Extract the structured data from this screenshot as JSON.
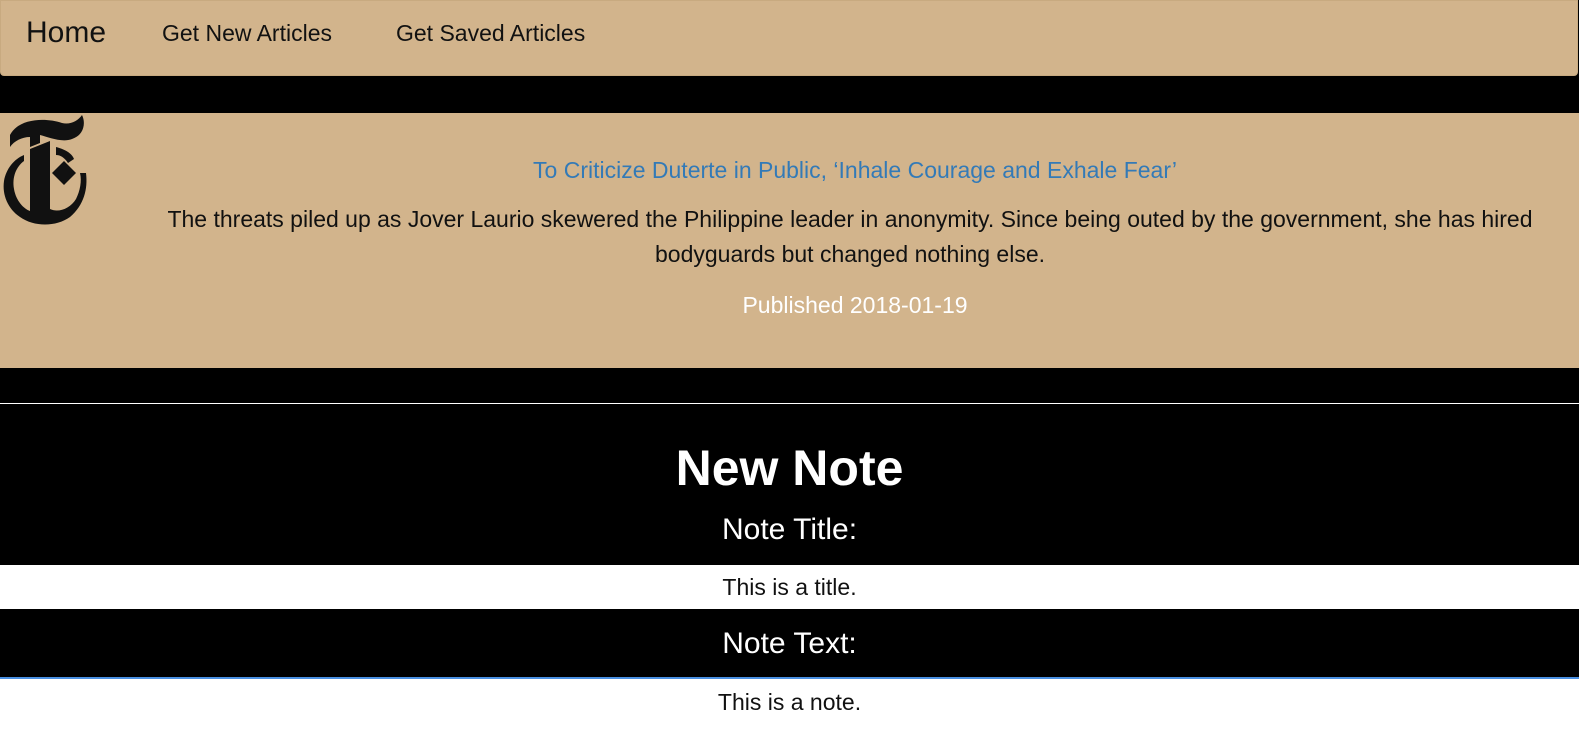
{
  "nav": {
    "brand": "Home",
    "links": [
      {
        "label": "Get New Articles"
      },
      {
        "label": "Get Saved Articles"
      }
    ]
  },
  "article": {
    "logo_icon": "nyt-logo-icon",
    "title": "To Criticize Duterte in Public, ‘Inhale Courage and Exhale Fear’",
    "summary": "The threats piled up as Jover Laurio skewered the Philippine leader in anonymity. Since being outed by the government, she has hired bodyguards but changed nothing else.",
    "published": "Published 2018-01-19"
  },
  "note_form": {
    "heading": "New Note",
    "title_label": "Note Title:",
    "title_value": "This is a title.",
    "text_label": "Note Text:",
    "text_value": "This is a note."
  },
  "colors": {
    "navbar_bg": "#d2b48c",
    "page_bg": "#000000",
    "link_blue": "#337ab7",
    "focus_border": "#4a90e2"
  }
}
